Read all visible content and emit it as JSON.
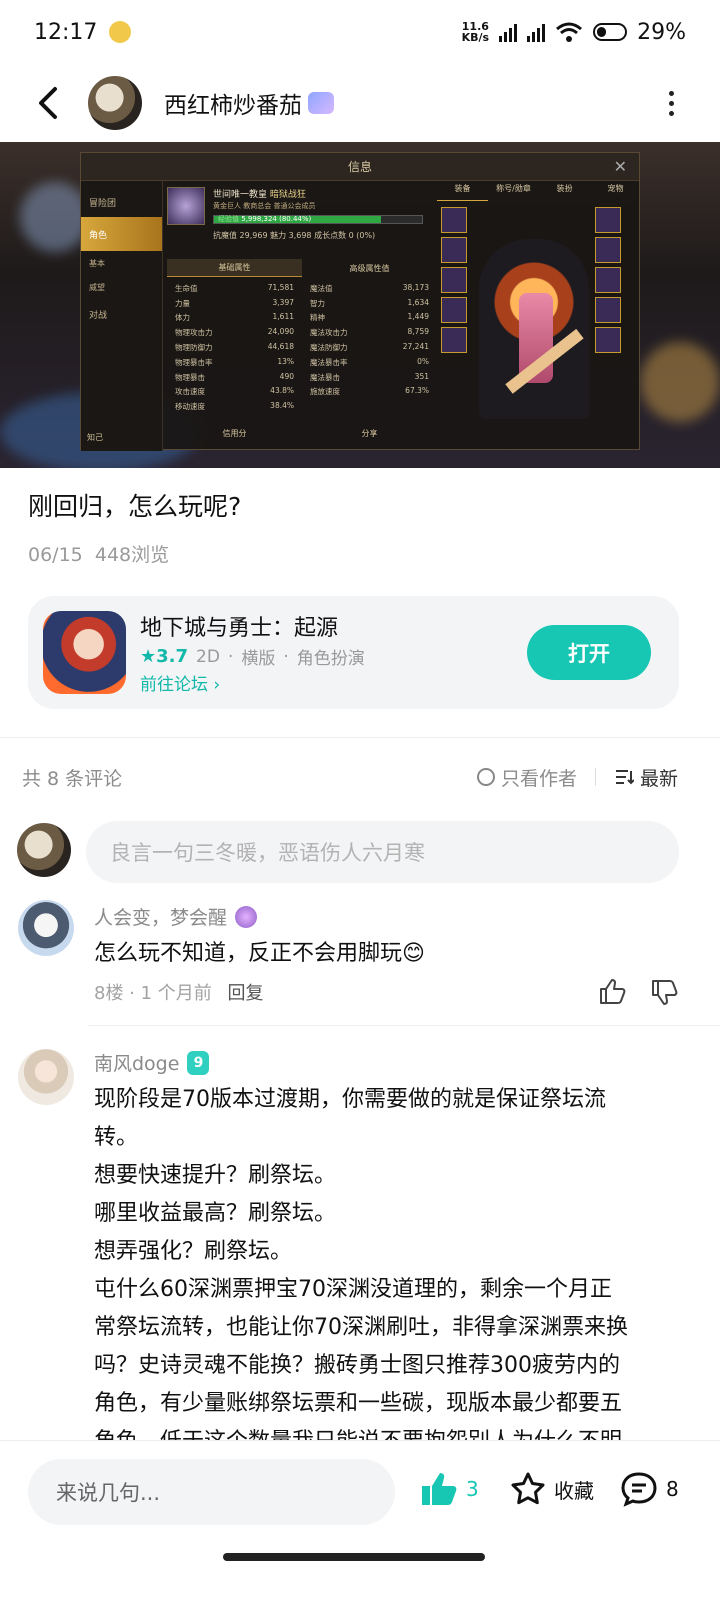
{
  "status_bar": {
    "time": "12:17",
    "net_speed_value": "11.6",
    "net_speed_unit": "KB/s",
    "battery": "29%"
  },
  "header": {
    "author": "西红柿炒番茄"
  },
  "game_screenshot": {
    "panel_title": "信息",
    "left_menu": [
      "冒险团",
      "角色",
      "基本",
      "威望",
      "对战"
    ],
    "char_name": "世间唯一教皇",
    "char_class": "暗狱战狂",
    "char_guild": "黄金巨人  教商总会  普通公会成员",
    "exp_label": "经验值",
    "exp_value": "5,998,324 (80.44%)",
    "exp_progress": 0.8044,
    "char_stats": "抗魔值 29,969  魅力 3,698  成长点数 0 (0%)",
    "tabs": [
      "基础属性",
      "高级属性值"
    ],
    "right_tabs": [
      "装备",
      "称号/勋章",
      "装扮",
      "宠物"
    ],
    "stats": [
      [
        "生命值",
        "71,581",
        "魔法值",
        "38,173"
      ],
      [
        "力量",
        "3,397",
        "智力",
        "1,634"
      ],
      [
        "体力",
        "1,611",
        "精神",
        "1,449"
      ],
      [
        "物理攻击力",
        "24,090",
        "魔法攻击力",
        "8,759"
      ],
      [
        "物理防御力",
        "44,618",
        "魔法防御力",
        "27,241"
      ],
      [
        "物理暴击率",
        "13%",
        "魔法暴击率",
        "0%"
      ],
      [
        "物理暴击",
        "490",
        "魔法暴击",
        "351"
      ],
      [
        "攻击速度",
        "43.8%",
        "施放速度",
        "67.3%"
      ],
      [
        "移动速度",
        "38.4%",
        "",
        ""
      ]
    ],
    "bottom_buttons": [
      "信用分",
      "分享"
    ],
    "bottom_left": "知己"
  },
  "post": {
    "title": "刚回归，怎么玩呢?",
    "date": "06/15",
    "views": "448浏览"
  },
  "game_card": {
    "name": "地下城与勇士：起源",
    "rating": "3.7",
    "tags": [
      "2D",
      "横版",
      "角色扮演"
    ],
    "link": "前往论坛",
    "open_label": "打开"
  },
  "comments_header": {
    "count": "共 8 条评论",
    "author_only": "只看作者",
    "sort": "最新"
  },
  "comment_input": {
    "placeholder": "良言一句三冬暖，恶语伤人六月寒"
  },
  "comments": [
    {
      "name": "人会变，梦会醒",
      "text": "怎么玩不知道，反正不会用脚玩😊",
      "floor": "8楼",
      "time": "1 个月前",
      "reply": "回复"
    },
    {
      "name": "南风doge",
      "badge": "9",
      "lines": [
        "现阶段是70版本过渡期，你需要做的就是保证祭坛流",
        "转。",
        "想要快速提升？刷祭坛。",
        "哪里收益最高？刷祭坛。",
        "想弄强化？刷祭坛。",
        "屯什么60深渊票押宝70深渊没道理的，剩余一个月正",
        "常祭坛流转，也能让你70深渊刷吐，非得拿深渊票来换",
        "吗？史诗灵魂不能换？搬砖勇士图只推荐300疲劳内的",
        "角色，有少量账绑祭坛票和一些碳，现版本最少都要五",
        "角色，低于这个数量我只能说不要抱怨别人为什么不明"
      ]
    }
  ],
  "bottom_bar": {
    "reply_placeholder": "来说几句...",
    "like_count": "3",
    "favorite_label": "收藏",
    "comment_count": "8"
  },
  "colors": {
    "accent": "#17c7b4",
    "text_primary": "#111111",
    "text_secondary": "#9a9a9a",
    "card_bg": "#f3f4f6"
  }
}
